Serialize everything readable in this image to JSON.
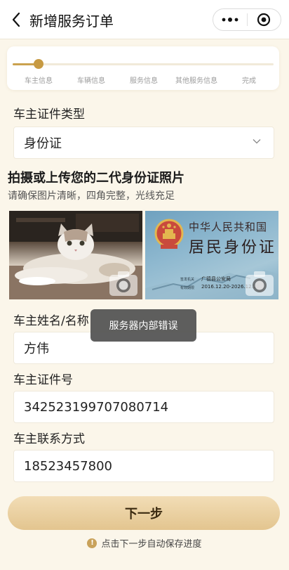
{
  "nav": {
    "title": "新增服务订单",
    "back_icon": "chevron-left-icon",
    "more_icon": "more-dots-icon",
    "close_icon": "target-circle-icon"
  },
  "steps": {
    "progress": 0.1,
    "items": [
      {
        "label": "车主信息"
      },
      {
        "label": "车辆信息"
      },
      {
        "label": "服务信息"
      },
      {
        "label": "其他服务信息"
      },
      {
        "label": "完成"
      }
    ]
  },
  "form": {
    "id_type": {
      "label": "车主证件类型",
      "value": "身份证"
    },
    "upload": {
      "title": "拍摄或上传您的二代身份证照片",
      "hint": "请确保图片清晰，四角完整，光线充足",
      "id_card": {
        "country": "中华人民共和国",
        "title": "居民身份证",
        "authority_label": "签发机关",
        "authority": "广德县公安局",
        "validity_label": "有效期限",
        "validity": "2016.12.20-2026.12.20"
      }
    },
    "owner_name": {
      "label": "车主姓名/名称",
      "value": "方伟"
    },
    "id_number": {
      "label": "车主证件号",
      "value": "342523199707080714"
    },
    "contact": {
      "label": "车主联系方式",
      "value": "18523457800"
    }
  },
  "toast": {
    "message": "服务器内部错误"
  },
  "actions": {
    "next_label": "下一步",
    "autosave_tip": "点击下一步自动保存进度"
  },
  "colors": {
    "accent": "#c79a42",
    "button": "#e8cd9c",
    "background": "#fbf6ea"
  }
}
